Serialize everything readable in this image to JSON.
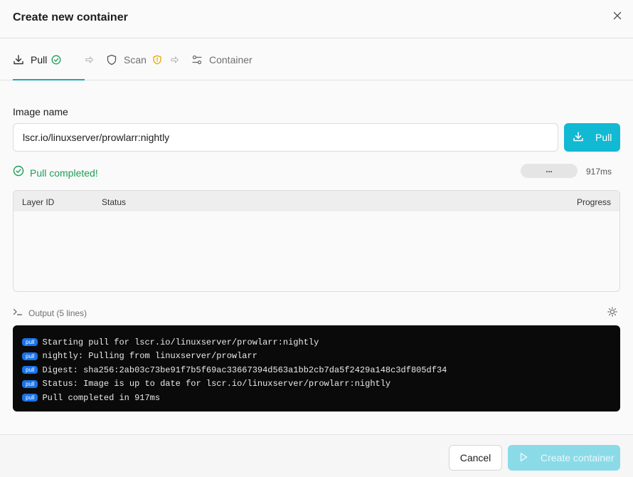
{
  "dialog": {
    "title": "Create new container"
  },
  "tabs": [
    {
      "label": "Pull",
      "status": "completed"
    },
    {
      "label": "Scan",
      "status": "warning"
    },
    {
      "label": "Container",
      "status": "pending"
    }
  ],
  "image": {
    "label": "Image name",
    "value": "lscr.io/linuxserver/prowlarr:nightly",
    "pull_button": "Pull"
  },
  "status": {
    "message": "Pull completed!",
    "pill": "...",
    "duration": "917ms"
  },
  "layers_table": {
    "columns": [
      "Layer ID",
      "Status",
      "Progress"
    ],
    "rows": []
  },
  "output": {
    "header": "Output (5 lines)",
    "lines": [
      {
        "badge": "pull",
        "text": "Starting pull for lscr.io/linuxserver/prowlarr:nightly"
      },
      {
        "badge": "pull",
        "text": "nightly: Pulling from linuxserver/prowlarr"
      },
      {
        "badge": "pull",
        "text": "Digest: sha256:2ab03c73be91f7b5f69ac33667394d563a1bb2cb7da5f2429a148c3df805df34"
      },
      {
        "badge": "pull",
        "text": "Status: Image is up to date for lscr.io/linuxserver/prowlarr:nightly"
      },
      {
        "badge": "pull",
        "text": "Pull completed in 917ms"
      }
    ]
  },
  "footer": {
    "cancel": "Cancel",
    "create": "Create container"
  },
  "colors": {
    "accent": "#12b9d3",
    "success": "#1c9e57",
    "warning": "#e6a700",
    "badge": "#1a73e8"
  }
}
